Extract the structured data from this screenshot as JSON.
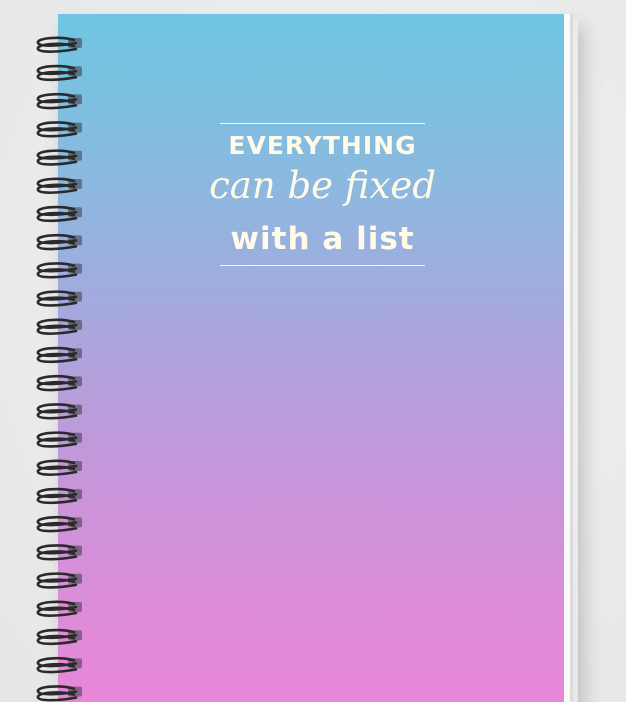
{
  "cover": {
    "line1": "EVERYTHING",
    "line2": "can be fixed",
    "line3": "with a list",
    "colors": {
      "gradient_top": "#6ec6e2",
      "gradient_mid": "#a9a6dc",
      "gradient_bottom": "#ea86da",
      "text": "#fffbe8",
      "background": "#ebebeb",
      "spiral": "#2a2a2a"
    }
  },
  "spiral": {
    "ring_count": 24,
    "icon": "spiral-binding"
  }
}
